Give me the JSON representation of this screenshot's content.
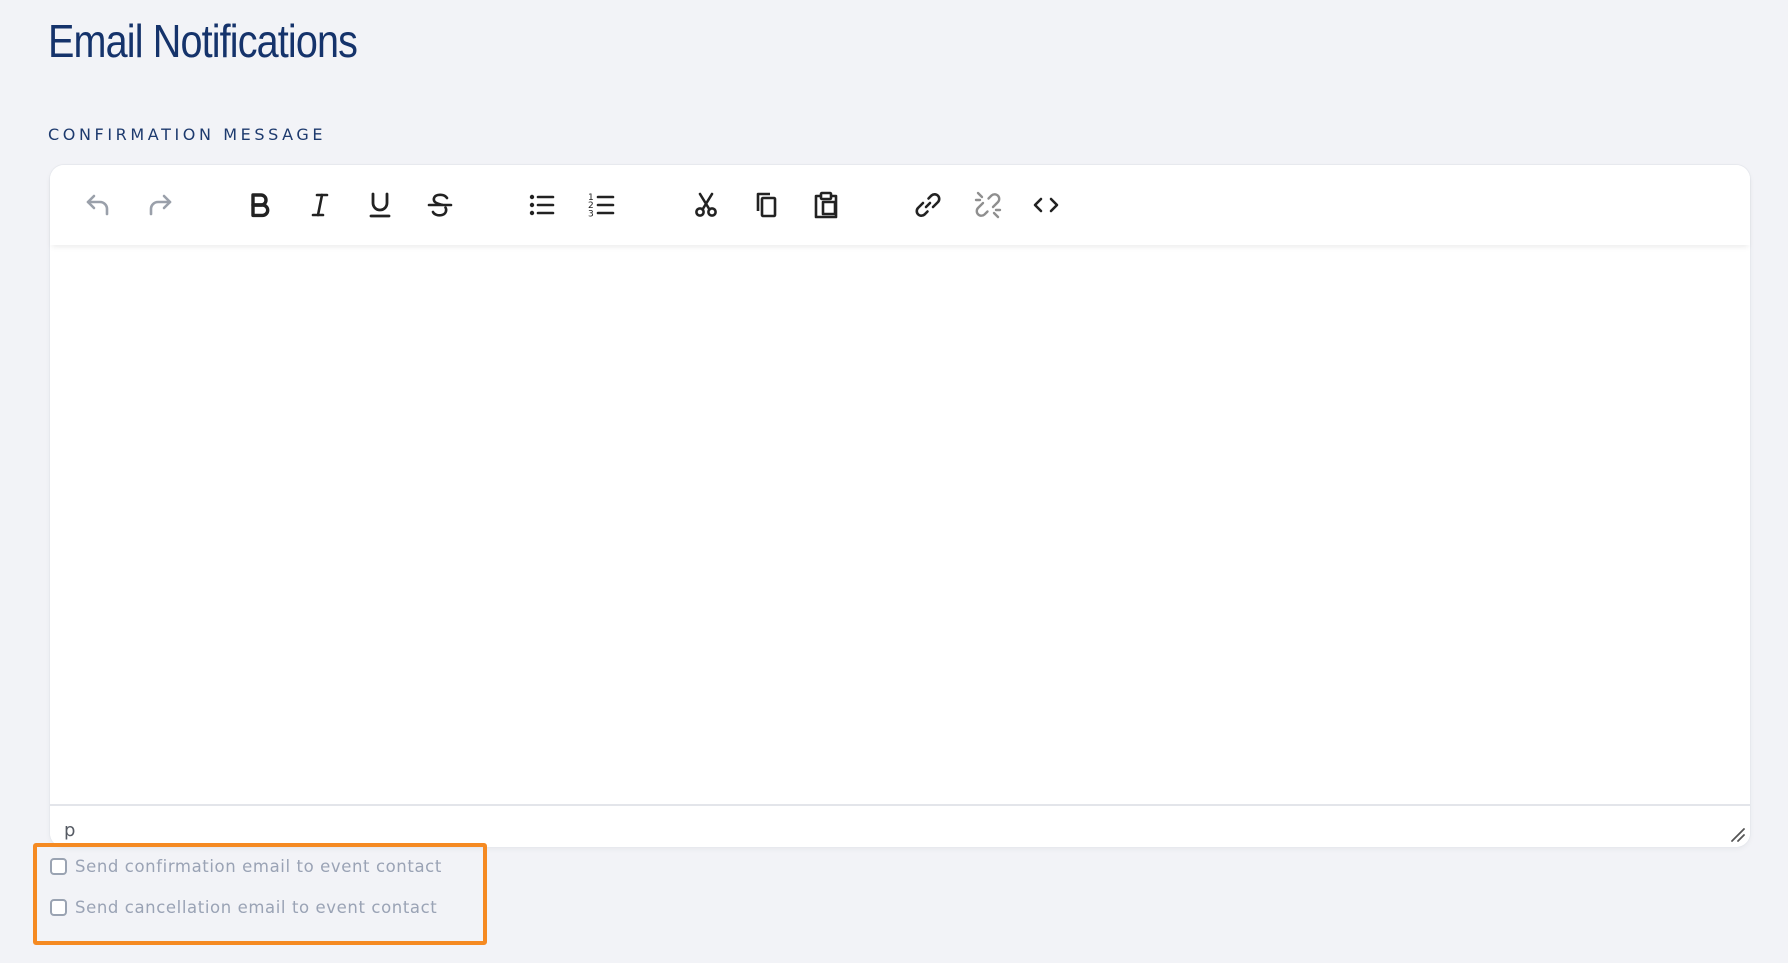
{
  "page": {
    "title": "Email Notifications"
  },
  "confirmation_message": {
    "label": "CONFIRMATION MESSAGE",
    "editor": {
      "content": "",
      "status_path": "p",
      "toolbar": [
        {
          "name": "undo",
          "icon": "undo-icon",
          "enabled": true
        },
        {
          "name": "redo",
          "icon": "redo-icon",
          "enabled": true
        },
        {
          "name": "bold",
          "icon": "bold-icon",
          "enabled": true
        },
        {
          "name": "italic",
          "icon": "italic-icon",
          "enabled": true
        },
        {
          "name": "underline",
          "icon": "underline-icon",
          "enabled": true
        },
        {
          "name": "strikethrough",
          "icon": "strikethrough-icon",
          "enabled": true
        },
        {
          "name": "bullet-list",
          "icon": "bullet-list-icon",
          "enabled": true
        },
        {
          "name": "numbered-list",
          "icon": "numbered-list-icon",
          "enabled": true
        },
        {
          "name": "cut",
          "icon": "scissors-icon",
          "enabled": true
        },
        {
          "name": "copy",
          "icon": "copy-icon",
          "enabled": true
        },
        {
          "name": "paste",
          "icon": "clipboard-icon",
          "enabled": true
        },
        {
          "name": "link",
          "icon": "link-icon",
          "enabled": true
        },
        {
          "name": "unlink",
          "icon": "unlink-icon",
          "enabled": false
        },
        {
          "name": "source-code",
          "icon": "code-icon",
          "enabled": true
        }
      ]
    }
  },
  "options": {
    "send_confirmation": {
      "label": "Send confirmation email to event contact",
      "checked": false
    },
    "send_cancellation": {
      "label": "Send cancellation email to event contact",
      "checked": false
    }
  },
  "colors": {
    "background": "#f2f3f7",
    "title": "#15336b",
    "highlight_border": "#f58a22",
    "icon": "#222222",
    "icon_muted": "#9aa0aa"
  }
}
